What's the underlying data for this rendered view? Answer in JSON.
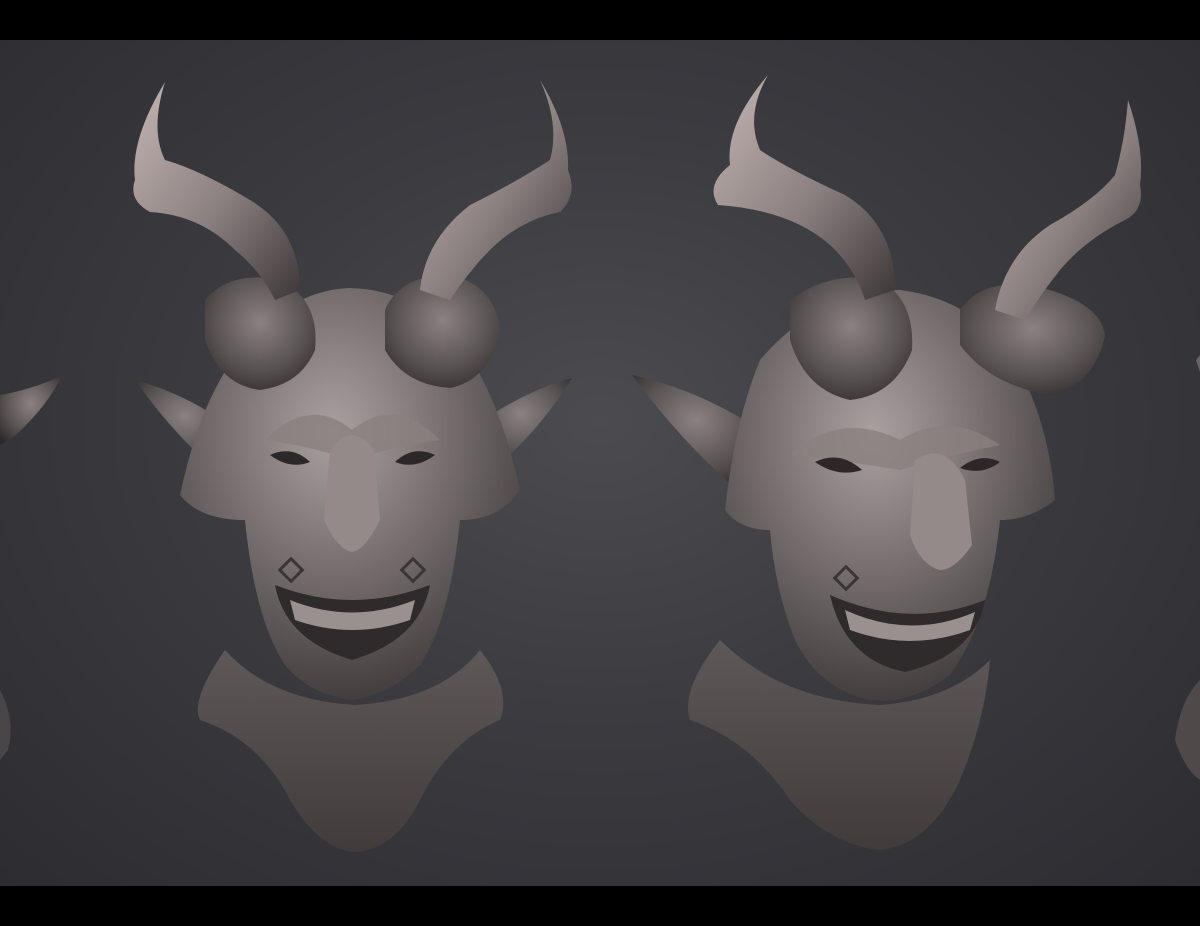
{
  "scene": {
    "description_colors": {
      "background": "#3a3a3f",
      "clay_light": "#a49a9a",
      "clay_mid": "#6f6868",
      "clay_dark": "#3a3536",
      "rim_light": "#c8a8a8"
    },
    "subjects": [
      "partial-sculpt-left",
      "demon-head-front",
      "demon-head-three-quarter",
      "partial-sculpt-right"
    ]
  }
}
